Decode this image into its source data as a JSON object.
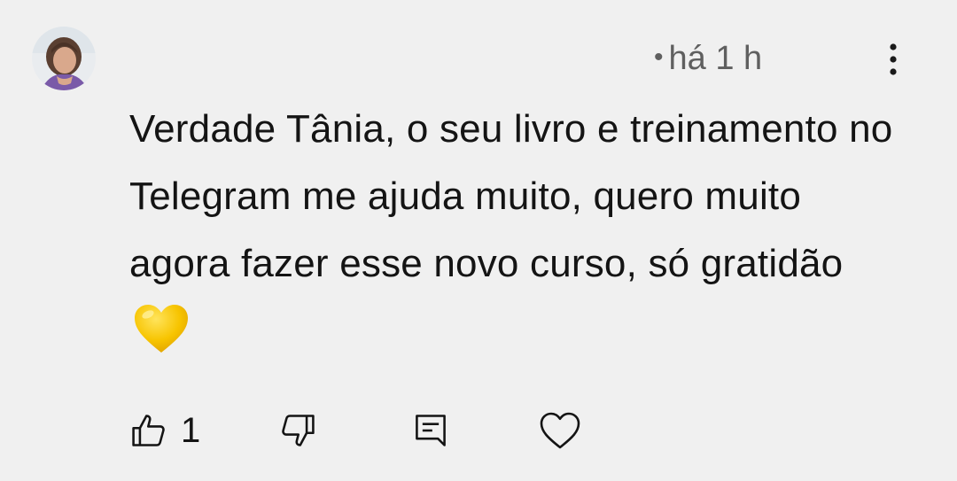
{
  "comment": {
    "timestamp": "há 1 h",
    "separator": "•",
    "text_before_emoji": "Verdade Tânia, o seu livro e treinamento no Telegram me ajuda muito, quero muito agora fazer esse novo curso, só gratidão",
    "emoji": "yellow-heart",
    "emoji_color": "#f7c400"
  },
  "actions": {
    "like_count": "1",
    "icons": {
      "like": "thumbs-up-icon",
      "dislike": "thumbs-down-icon",
      "reply": "reply-comment-icon",
      "heart": "heart-outline-icon",
      "more": "more-vert-icon"
    }
  },
  "colors": {
    "background": "#f0f0f0",
    "text": "#141414",
    "meta_text": "#5f5f5f"
  }
}
